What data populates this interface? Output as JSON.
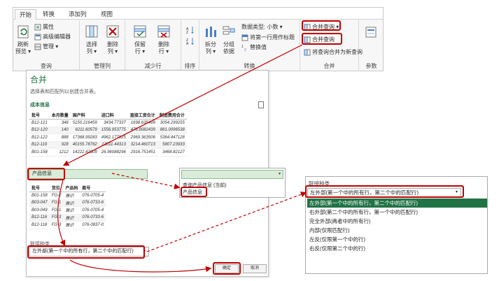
{
  "ribbon": {
    "tabs": [
      "开始",
      "转换",
      "添加列",
      "视图"
    ],
    "groups": {
      "query": {
        "label": "查询",
        "refresh_preview": [
          "刷新",
          "预览 ▾"
        ],
        "properties": "属性",
        "advanced_editor": "高级编辑器",
        "manage": "管理 ▾"
      },
      "manage_columns": {
        "label": "管理列",
        "choose_columns": [
          "选择",
          "列 ▾"
        ],
        "remove_columns": [
          "删除",
          "列 ▾"
        ]
      },
      "reduce_rows": {
        "label": "减少行",
        "keep_rows": [
          "保留",
          "行 ▾"
        ],
        "remove_rows": [
          "删除",
          "行 ▾"
        ]
      },
      "sort": {
        "label": "排序"
      },
      "transform": {
        "label": "转换",
        "split_column": [
          "拆分",
          "列 ▾"
        ],
        "group_by": [
          "分组",
          "依据"
        ],
        "data_type": "数据类型: 小数 ▾",
        "first_row_header": "将第一行用作标题",
        "replace_values": "替换值"
      },
      "combine": {
        "label": "合并",
        "merge_queries": "合并查询 ▾",
        "merge_queries_item": "合并查询",
        "merge_as_new": "将查询合并为新查询"
      },
      "parameters": {
        "label": "参数"
      }
    }
  },
  "dialog": {
    "title": "合并",
    "description": "选择表和匹配列以创建合并表。",
    "table1": {
      "name": "成本信息",
      "columns": [
        "批号",
        "本月数量",
        "国产料",
        "进口料",
        "直接工资合计",
        "制造费用合计"
      ],
      "rows": [
        [
          "B12-121",
          "348",
          "5150.216459",
          "3434.77337",
          "1698.635499",
          "3054.299255"
        ],
        [
          "B12-120",
          "140",
          "6211.60579",
          "1556.953775",
          "476.6082439",
          "861.0096538"
        ],
        [
          "B12-122",
          "888",
          "17368.99283",
          "4962.177925",
          "2969.363506",
          "5364.447128"
        ],
        [
          "B12-119",
          "928",
          "40155.78762",
          "13011.44313",
          "3214.460713",
          "5807.23933"
        ],
        [
          "B01-158",
          "1212",
          "14222.42309",
          "26.96088296",
          "2916.751451",
          "3468.82127"
        ]
      ]
    },
    "table2": {
      "selected": "产品信息",
      "columns": [
        "批号",
        "货位",
        "产品码",
        "款号"
      ],
      "rows": [
        [
          "B01-158",
          "FG-2",
          "雅识",
          "076-0705-4"
        ],
        [
          "B03-047",
          "FG-1",
          "雅识",
          "076-0733-6"
        ],
        [
          "B03-049",
          "FG-1",
          "雅识",
          "076-0705-4"
        ],
        [
          "B12-116",
          "FG-3",
          "雅识",
          "076-0733-6"
        ],
        [
          "B12-118",
          "FG-3",
          "雅识",
          "076-0837-0"
        ]
      ]
    },
    "join_kind_label": "联接种类",
    "join_kind_value": "左外部(第一个中的所有行，第二个中的匹配行)",
    "ok": "确定",
    "cancel": "取消"
  },
  "query_dropdown": {
    "options": [
      "查询产品信息 (当前)",
      "产品信息"
    ]
  },
  "join_panel": {
    "title": "联接种类",
    "selected": "左外部(第一个中的所有行，第二个中的匹配行)",
    "options": [
      "左外部(第一个中的所有行，第二个中的匹配行)",
      "右外部(第二个中的所有行，第一个中的匹配行)",
      "完全外部(两者中的所有行)",
      "内部(仅限匹配行)",
      "左反(仅限第一个中的行)",
      "右反(仅限第二个中的行)"
    ]
  },
  "colors": {
    "accent": "#217346",
    "highlight": "#c00000",
    "selection_green": "#d9ebd9"
  }
}
